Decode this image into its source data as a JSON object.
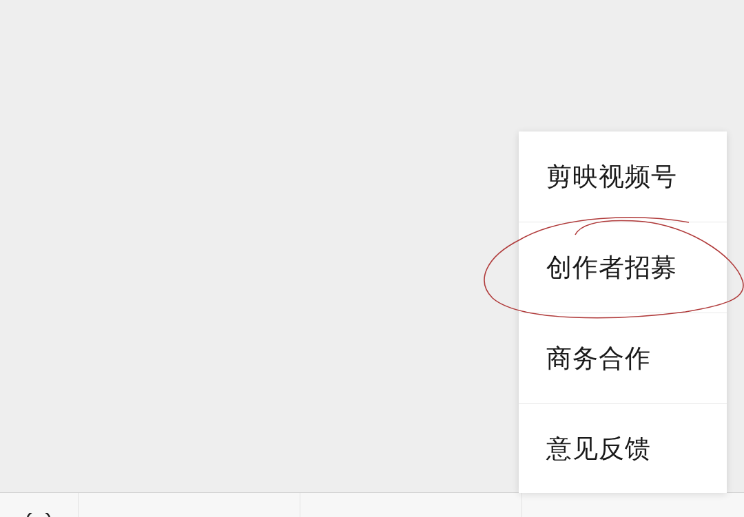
{
  "menu": {
    "items": [
      {
        "label": "剪映视频号"
      },
      {
        "label": "创作者招募"
      },
      {
        "label": "商务合作"
      },
      {
        "label": "意见反馈"
      }
    ]
  }
}
